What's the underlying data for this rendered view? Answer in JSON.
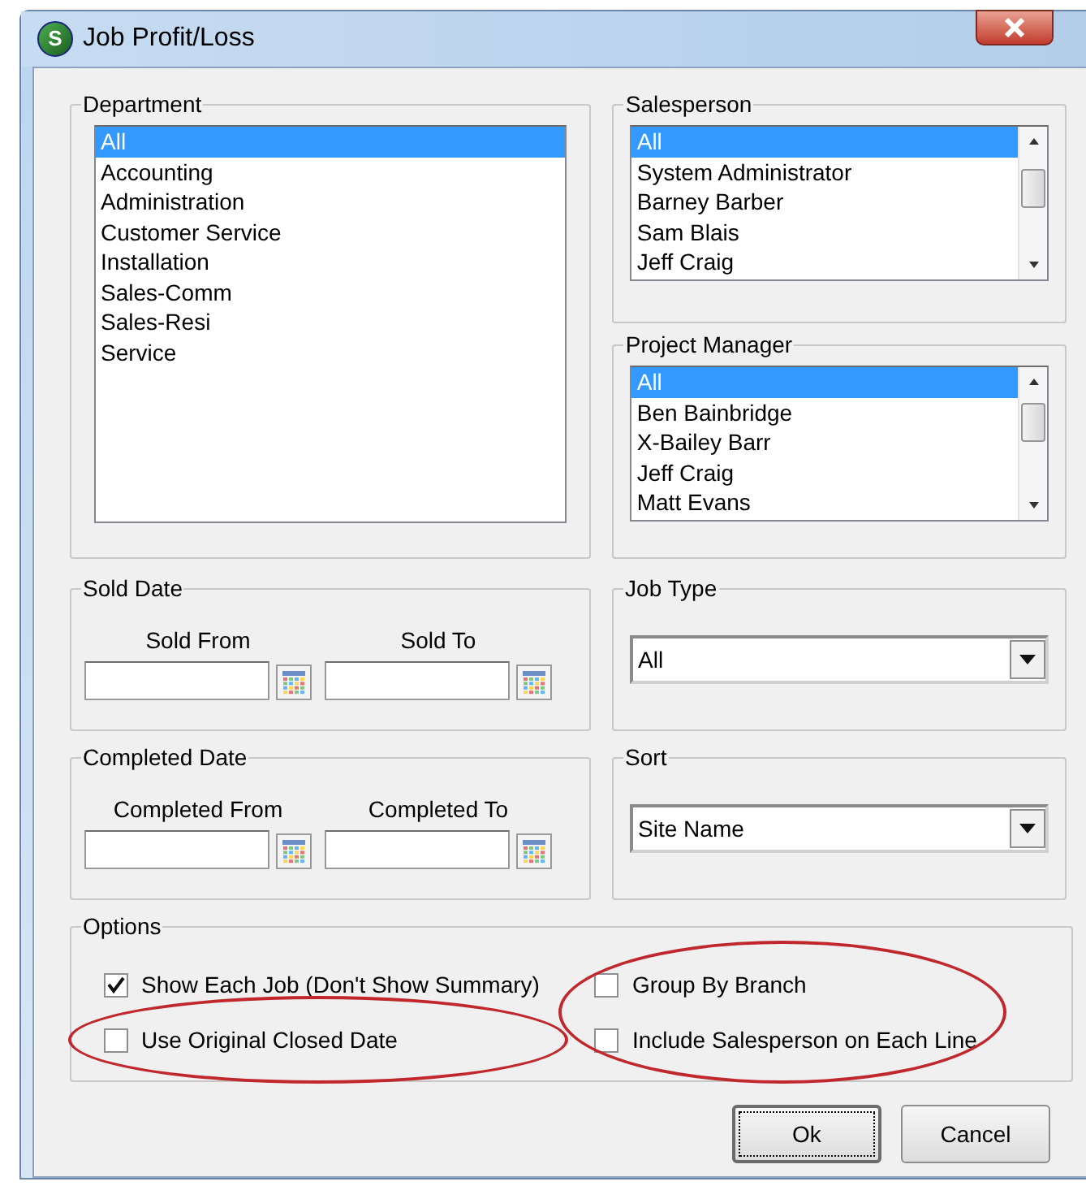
{
  "window": {
    "title": "Job Profit/Loss",
    "icon_letter": "S"
  },
  "department": {
    "title": "Department",
    "items": [
      {
        "label": "All",
        "selected": true
      },
      {
        "label": "Accounting",
        "selected": false
      },
      {
        "label": "Administration",
        "selected": false
      },
      {
        "label": "Customer Service",
        "selected": false
      },
      {
        "label": "Installation",
        "selected": false
      },
      {
        "label": "Sales-Comm",
        "selected": false
      },
      {
        "label": "Sales-Resi",
        "selected": false
      },
      {
        "label": "Service",
        "selected": false
      }
    ]
  },
  "salesperson": {
    "title": "Salesperson",
    "items": [
      {
        "label": "All",
        "selected": true
      },
      {
        "label": "System Administrator",
        "selected": false
      },
      {
        "label": "Barney Barber",
        "selected": false
      },
      {
        "label": "Sam Blais",
        "selected": false
      },
      {
        "label": "Jeff Craig",
        "selected": false
      }
    ]
  },
  "project_manager": {
    "title": "Project Manager",
    "items": [
      {
        "label": "All",
        "selected": true
      },
      {
        "label": "Ben Bainbridge",
        "selected": false
      },
      {
        "label": "X-Bailey Barr",
        "selected": false
      },
      {
        "label": "Jeff Craig",
        "selected": false
      },
      {
        "label": "Matt Evans",
        "selected": false
      }
    ]
  },
  "sold_date": {
    "title": "Sold Date",
    "fields": [
      {
        "label": "Sold From"
      },
      {
        "label": "Sold To"
      }
    ]
  },
  "job_type": {
    "title": "Job Type",
    "value": "All"
  },
  "completed_date": {
    "title": "Completed Date",
    "fields": [
      {
        "label": "Completed From"
      },
      {
        "label": "Completed To"
      }
    ]
  },
  "sort": {
    "title": "Sort",
    "value": "Site Name"
  },
  "options": {
    "title": "Options",
    "columns": [
      [
        {
          "label": "Show Each Job (Don't Show Summary)",
          "checked": true,
          "circled": false
        },
        {
          "label": "Use Original Closed Date",
          "checked": false,
          "circled": true
        }
      ],
      [
        {
          "label": "Group By Branch",
          "checked": false,
          "circled": true
        },
        {
          "label": "Include Salesperson on Each Line",
          "checked": false,
          "circled": true
        }
      ]
    ]
  },
  "buttons": [
    {
      "label": "Ok",
      "focused": true
    },
    {
      "label": "Cancel",
      "focused": false
    }
  ]
}
